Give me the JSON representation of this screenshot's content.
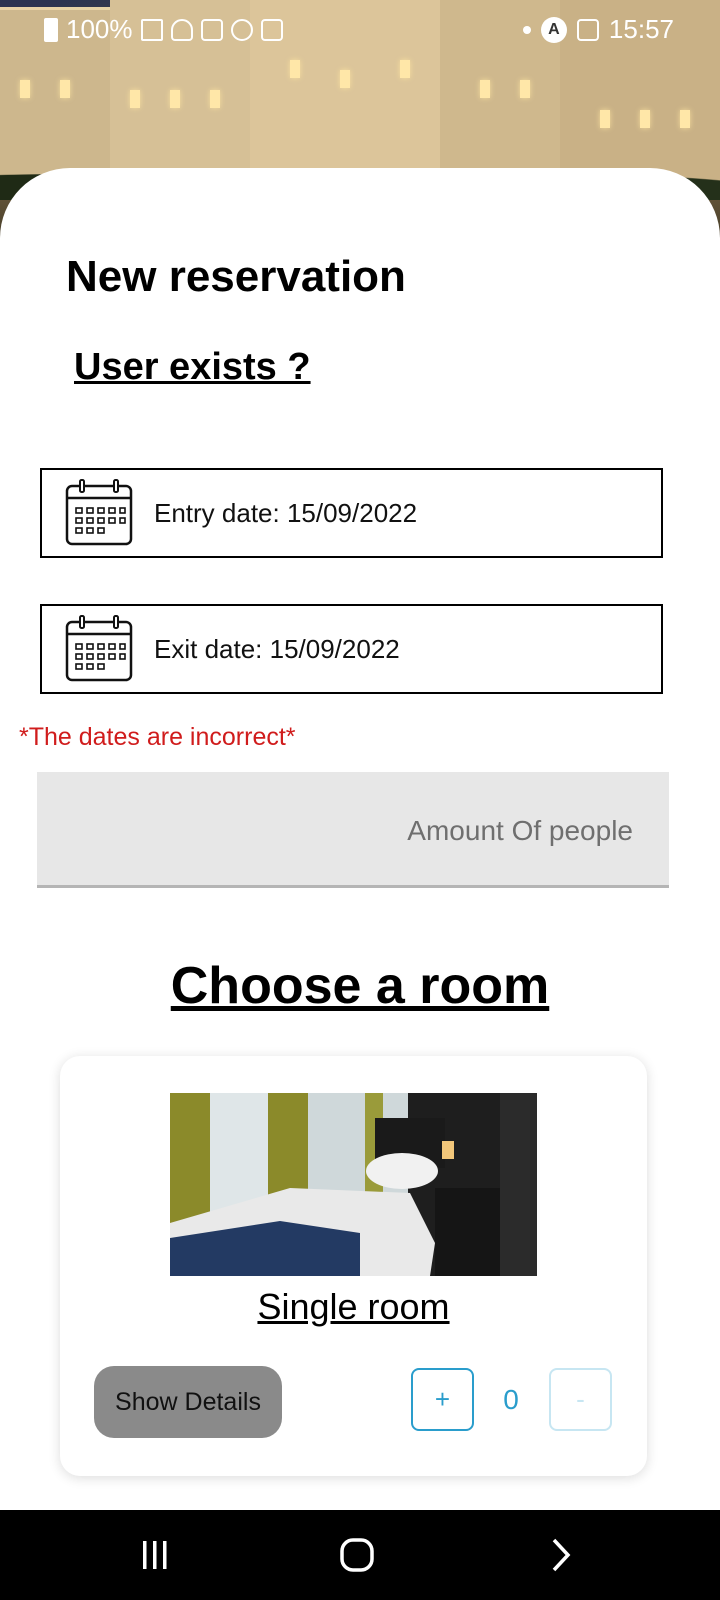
{
  "status_bar": {
    "battery": "100%",
    "time": "15:57"
  },
  "page": {
    "title": "New reservation",
    "user_exists_link": "User exists ?"
  },
  "dates": {
    "entry_label": "Entry date: 15/09/2022",
    "exit_label": "Exit date: 15/09/2022",
    "error_message": "*The dates are incorrect*"
  },
  "people": {
    "placeholder": "Amount Of people",
    "value": ""
  },
  "rooms": {
    "heading": "Choose a room",
    "items": [
      {
        "name": "Single room",
        "details_label": "Show Details",
        "plus_label": "+",
        "minus_label": "-",
        "quantity": "0"
      }
    ]
  },
  "colors": {
    "accent": "#2a9dcc",
    "error": "#d01c1c",
    "details_button": "#8a8a8a",
    "input_background": "#e7e7e7"
  },
  "icons": {
    "date": "calendar-icon",
    "nav_recent": "recent-apps-icon",
    "nav_home": "home-icon",
    "nav_back": "back-icon"
  }
}
